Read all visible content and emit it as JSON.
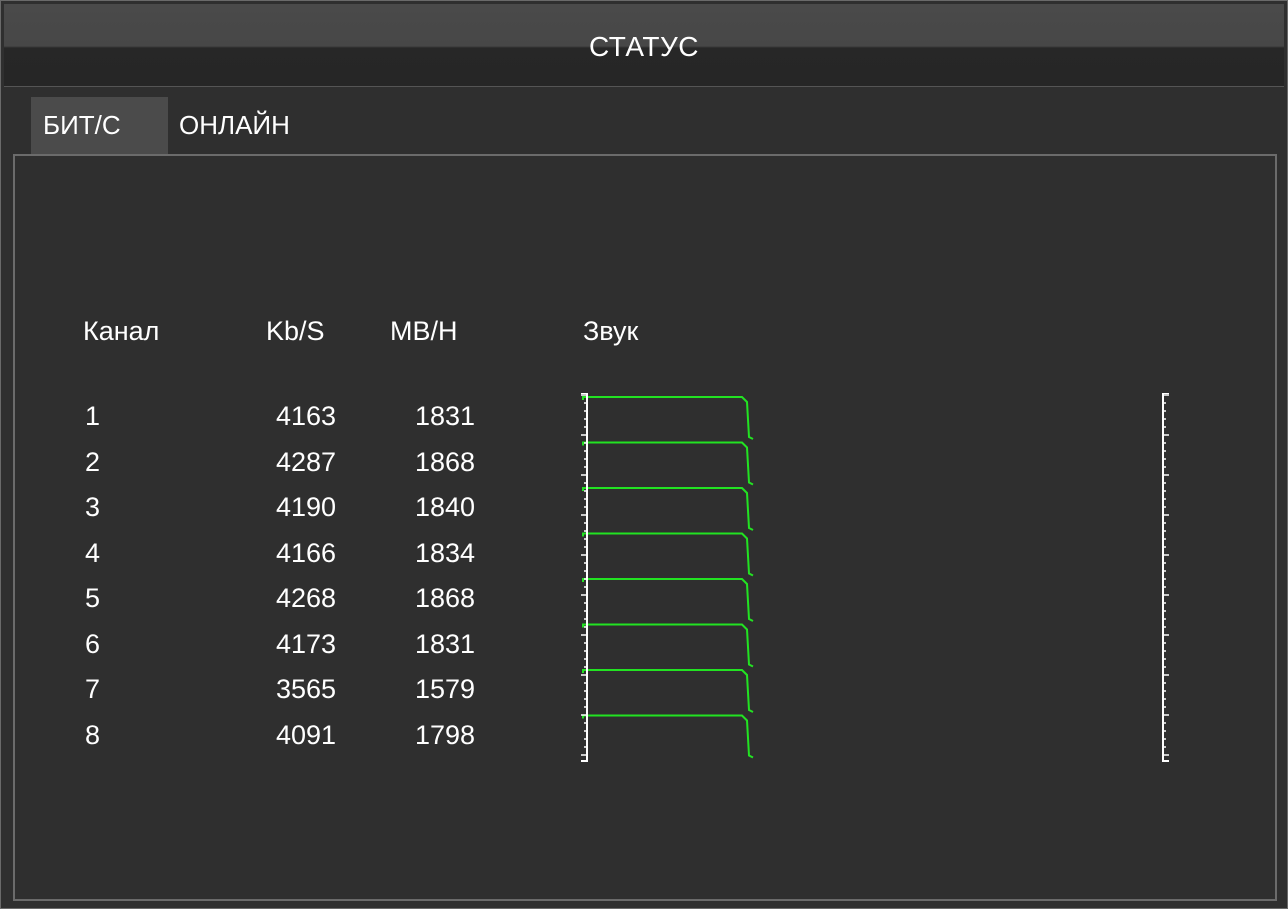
{
  "window": {
    "title": "СТАТУС"
  },
  "tabs": [
    {
      "label": "БИТ/С",
      "active": true
    },
    {
      "label": "ОНЛАЙН",
      "active": false
    }
  ],
  "table": {
    "headers": {
      "channel": "Канал",
      "kbps": "Kb/S",
      "mbh": "MB/H",
      "audio": "Звук"
    },
    "rows": [
      {
        "channel": "1",
        "kbps": "4163",
        "mbh": "1831"
      },
      {
        "channel": "2",
        "kbps": "4287",
        "mbh": "1868"
      },
      {
        "channel": "3",
        "kbps": "4190",
        "mbh": "1840"
      },
      {
        "channel": "4",
        "kbps": "4166",
        "mbh": "1834"
      },
      {
        "channel": "5",
        "kbps": "4268",
        "mbh": "1868"
      },
      {
        "channel": "6",
        "kbps": "4173",
        "mbh": "1831"
      },
      {
        "channel": "7",
        "kbps": "3565",
        "mbh": "1579"
      },
      {
        "channel": "8",
        "kbps": "4091",
        "mbh": "1798"
      }
    ]
  },
  "colors": {
    "audio_trace": "#22e322",
    "scale": "#ffffff"
  }
}
